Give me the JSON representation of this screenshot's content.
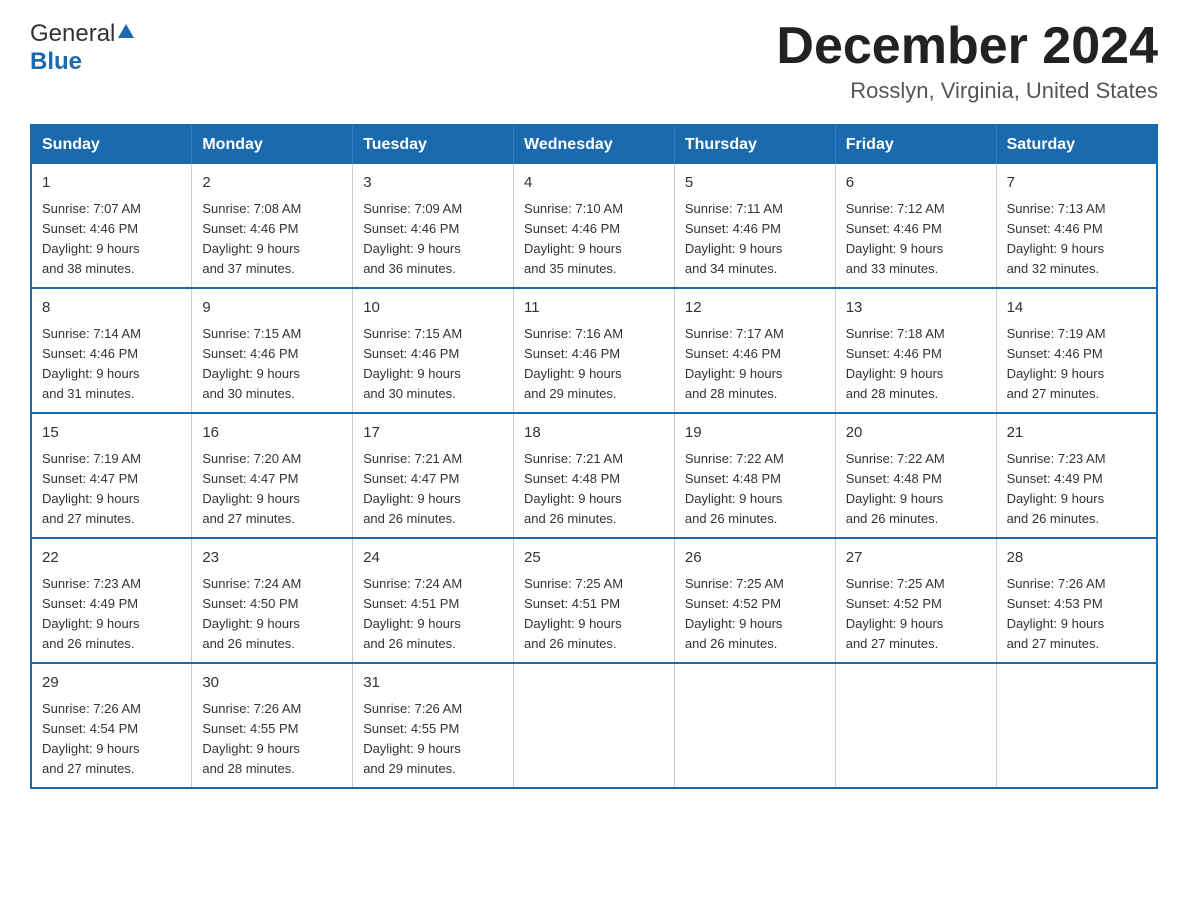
{
  "logo": {
    "general": "General",
    "blue": "Blue",
    "triangle": "▲"
  },
  "title": {
    "month_year": "December 2024",
    "location": "Rosslyn, Virginia, United States"
  },
  "weekdays": [
    "Sunday",
    "Monday",
    "Tuesday",
    "Wednesday",
    "Thursday",
    "Friday",
    "Saturday"
  ],
  "weeks": [
    [
      {
        "day": "1",
        "sunrise": "7:07 AM",
        "sunset": "4:46 PM",
        "daylight": "9 hours and 38 minutes."
      },
      {
        "day": "2",
        "sunrise": "7:08 AM",
        "sunset": "4:46 PM",
        "daylight": "9 hours and 37 minutes."
      },
      {
        "day": "3",
        "sunrise": "7:09 AM",
        "sunset": "4:46 PM",
        "daylight": "9 hours and 36 minutes."
      },
      {
        "day": "4",
        "sunrise": "7:10 AM",
        "sunset": "4:46 PM",
        "daylight": "9 hours and 35 minutes."
      },
      {
        "day": "5",
        "sunrise": "7:11 AM",
        "sunset": "4:46 PM",
        "daylight": "9 hours and 34 minutes."
      },
      {
        "day": "6",
        "sunrise": "7:12 AM",
        "sunset": "4:46 PM",
        "daylight": "9 hours and 33 minutes."
      },
      {
        "day": "7",
        "sunrise": "7:13 AM",
        "sunset": "4:46 PM",
        "daylight": "9 hours and 32 minutes."
      }
    ],
    [
      {
        "day": "8",
        "sunrise": "7:14 AM",
        "sunset": "4:46 PM",
        "daylight": "9 hours and 31 minutes."
      },
      {
        "day": "9",
        "sunrise": "7:15 AM",
        "sunset": "4:46 PM",
        "daylight": "9 hours and 30 minutes."
      },
      {
        "day": "10",
        "sunrise": "7:15 AM",
        "sunset": "4:46 PM",
        "daylight": "9 hours and 30 minutes."
      },
      {
        "day": "11",
        "sunrise": "7:16 AM",
        "sunset": "4:46 PM",
        "daylight": "9 hours and 29 minutes."
      },
      {
        "day": "12",
        "sunrise": "7:17 AM",
        "sunset": "4:46 PM",
        "daylight": "9 hours and 28 minutes."
      },
      {
        "day": "13",
        "sunrise": "7:18 AM",
        "sunset": "4:46 PM",
        "daylight": "9 hours and 28 minutes."
      },
      {
        "day": "14",
        "sunrise": "7:19 AM",
        "sunset": "4:46 PM",
        "daylight": "9 hours and 27 minutes."
      }
    ],
    [
      {
        "day": "15",
        "sunrise": "7:19 AM",
        "sunset": "4:47 PM",
        "daylight": "9 hours and 27 minutes."
      },
      {
        "day": "16",
        "sunrise": "7:20 AM",
        "sunset": "4:47 PM",
        "daylight": "9 hours and 27 minutes."
      },
      {
        "day": "17",
        "sunrise": "7:21 AM",
        "sunset": "4:47 PM",
        "daylight": "9 hours and 26 minutes."
      },
      {
        "day": "18",
        "sunrise": "7:21 AM",
        "sunset": "4:48 PM",
        "daylight": "9 hours and 26 minutes."
      },
      {
        "day": "19",
        "sunrise": "7:22 AM",
        "sunset": "4:48 PM",
        "daylight": "9 hours and 26 minutes."
      },
      {
        "day": "20",
        "sunrise": "7:22 AM",
        "sunset": "4:48 PM",
        "daylight": "9 hours and 26 minutes."
      },
      {
        "day": "21",
        "sunrise": "7:23 AM",
        "sunset": "4:49 PM",
        "daylight": "9 hours and 26 minutes."
      }
    ],
    [
      {
        "day": "22",
        "sunrise": "7:23 AM",
        "sunset": "4:49 PM",
        "daylight": "9 hours and 26 minutes."
      },
      {
        "day": "23",
        "sunrise": "7:24 AM",
        "sunset": "4:50 PM",
        "daylight": "9 hours and 26 minutes."
      },
      {
        "day": "24",
        "sunrise": "7:24 AM",
        "sunset": "4:51 PM",
        "daylight": "9 hours and 26 minutes."
      },
      {
        "day": "25",
        "sunrise": "7:25 AM",
        "sunset": "4:51 PM",
        "daylight": "9 hours and 26 minutes."
      },
      {
        "day": "26",
        "sunrise": "7:25 AM",
        "sunset": "4:52 PM",
        "daylight": "9 hours and 26 minutes."
      },
      {
        "day": "27",
        "sunrise": "7:25 AM",
        "sunset": "4:52 PM",
        "daylight": "9 hours and 27 minutes."
      },
      {
        "day": "28",
        "sunrise": "7:26 AM",
        "sunset": "4:53 PM",
        "daylight": "9 hours and 27 minutes."
      }
    ],
    [
      {
        "day": "29",
        "sunrise": "7:26 AM",
        "sunset": "4:54 PM",
        "daylight": "9 hours and 27 minutes."
      },
      {
        "day": "30",
        "sunrise": "7:26 AM",
        "sunset": "4:55 PM",
        "daylight": "9 hours and 28 minutes."
      },
      {
        "day": "31",
        "sunrise": "7:26 AM",
        "sunset": "4:55 PM",
        "daylight": "9 hours and 29 minutes."
      },
      null,
      null,
      null,
      null
    ]
  ]
}
